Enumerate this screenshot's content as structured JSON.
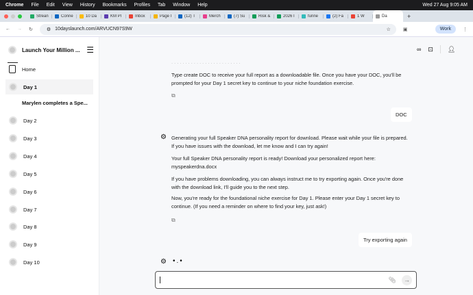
{
  "menubar": {
    "apple": "",
    "app": "Chrome",
    "items": [
      "File",
      "Edit",
      "View",
      "History",
      "Bookmarks",
      "Profiles",
      "Tab",
      "Window",
      "Help"
    ],
    "datetime": "Wed 27 Aug  9:05 AM"
  },
  "tabs": [
    {
      "label": "Strean",
      "color": "#2a6"
    },
    {
      "label": "Conne",
      "color": "#0a66c2"
    },
    {
      "label": "10 Da",
      "color": "#fbbc04"
    },
    {
      "label": "KM Pl",
      "color": "#5b3bb0"
    },
    {
      "label": "Inbox",
      "color": "#ea4335"
    },
    {
      "label": "Page I",
      "color": "#f4b400"
    },
    {
      "label": "(12) T",
      "color": "#0a66c2"
    },
    {
      "label": "Merch",
      "color": "#e83e8c"
    },
    {
      "label": "(7) Su",
      "color": "#0a66c2"
    },
    {
      "label": "Risk &",
      "color": "#0f9d58"
    },
    {
      "label": "2026 I",
      "color": "#0f9d58"
    },
    {
      "label": "funne",
      "color": "#3bb"
    },
    {
      "label": "(2) Fa",
      "color": "#1877f2"
    },
    {
      "label": "1 W",
      "color": "#ea4335"
    },
    {
      "label": "Da",
      "color": "#999",
      "active": true
    }
  ],
  "address": {
    "url": "10dayslaunch.com/ARVUCN97S9W",
    "profile": "Work"
  },
  "sidebar": {
    "title": "Launch Your Million ...",
    "items": [
      {
        "label": "Home"
      },
      {
        "label": "Day 1",
        "active": true
      },
      {
        "label": "Marylen completes a Spe...",
        "sub": true
      },
      {
        "label": "Day 2"
      },
      {
        "label": "Day 3"
      },
      {
        "label": "Day 4"
      },
      {
        "label": "Day 5"
      },
      {
        "label": "Day 6"
      },
      {
        "label": "Day 7"
      },
      {
        "label": "Day 8"
      },
      {
        "label": "Day 9"
      },
      {
        "label": "Day 10"
      }
    ]
  },
  "chat": {
    "m1": "Type create DOC to receive your full report as a downloadable file. Once you have your DOC, you'll be prompted for your Day 1 secret key to continue to your niche foundation exercise.",
    "u1": "DOC",
    "m2p1": "Generating your full Speaker DNA personality report for download. Please wait while your file is prepared. If you have issues with the download, let me know and I can try again!",
    "m2p2": "Your full Speaker DNA personality report is ready! Download your personalized report here: myspeakerdna.docx",
    "m2p3": "If you have problems downloading, you can always instruct me to try exporting again. Once you're done with the download link, I'll guide you to the next step.",
    "m2p4": "Now, you're ready for the foundational niche exercise for Day 1. Please enter your Day 1 secret key to continue. (If you need a reminder on where to find your key, just ask!)",
    "u2": "Try exporting again",
    "typing": "•.•"
  }
}
